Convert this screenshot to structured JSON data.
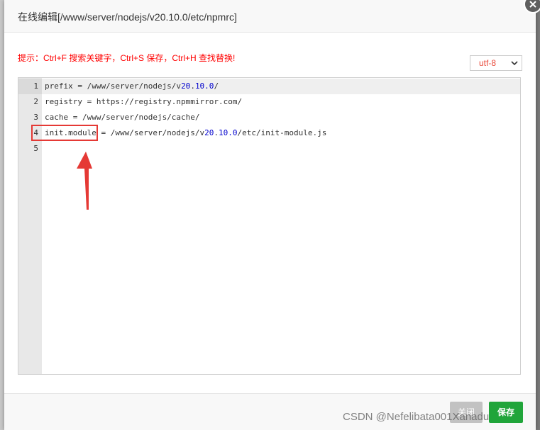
{
  "dialog": {
    "title": "在线编辑[/www/server/nodejs/v20.10.0/etc/npmrc]",
    "hint": "提示：Ctrl+F 搜索关键字，Ctrl+S 保存，Ctrl+H 查找替换!",
    "encoding": {
      "selected": "utf-8"
    }
  },
  "editor": {
    "lines": [
      {
        "num": "1",
        "pre": "prefix = /www/server/nodejs/v",
        "n1": "20",
        "dot": ".",
        "n2": "10.0",
        "post": "/"
      },
      {
        "num": "2",
        "text": "registry = https://registry.npmmirror.com/"
      },
      {
        "num": "3",
        "text": "cache = /www/server/nodejs/cache/"
      },
      {
        "num": "4",
        "pre": "init.module = /www/server/nodejs/v",
        "n1": "20",
        "dot": ".",
        "n2": "10.0",
        "post": "/etc/init-module.js"
      },
      {
        "num": "5",
        "text": ""
      }
    ]
  },
  "footer": {
    "close_label": "关闭",
    "save_label": "保存"
  },
  "watermark": "CSDN @Nefelibata001Xanadu",
  "colors": {
    "accent_green": "#20a53a",
    "hint_red": "#ff0000",
    "annotation_red": "#e53935",
    "number_blue": "#0000cd"
  },
  "icons": {
    "close": "close-icon",
    "dropdown": "chevron-down-icon",
    "annotation": "arrow-up-icon"
  }
}
